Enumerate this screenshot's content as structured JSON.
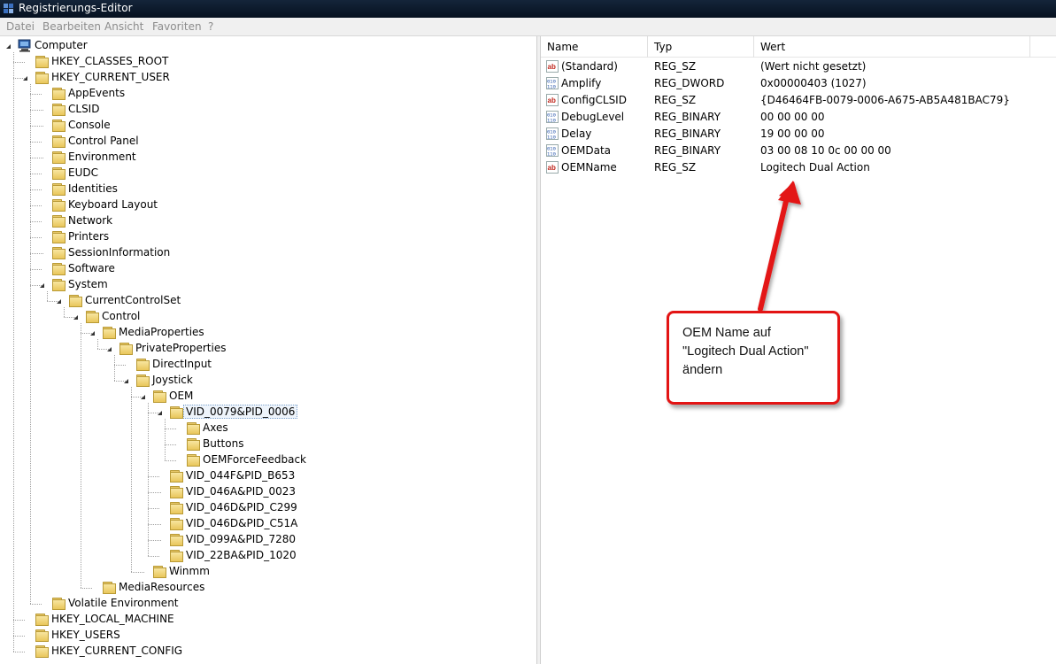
{
  "window": {
    "title": "Registrierungs-Editor"
  },
  "menu": [
    "Datei",
    "Bearbeiten",
    "Ansicht",
    "Favoriten",
    "?"
  ],
  "tree": [
    {
      "label": "Computer",
      "depth": 0,
      "state": "open",
      "icon": "computer-icon"
    },
    {
      "label": "HKEY_CLASSES_ROOT",
      "depth": 1,
      "state": "closed"
    },
    {
      "label": "HKEY_CURRENT_USER",
      "depth": 1,
      "state": "open"
    },
    {
      "label": "AppEvents",
      "depth": 2,
      "state": "closed"
    },
    {
      "label": "CLSID",
      "depth": 2,
      "state": "none"
    },
    {
      "label": "Console",
      "depth": 2,
      "state": "none"
    },
    {
      "label": "Control Panel",
      "depth": 2,
      "state": "closed"
    },
    {
      "label": "Environment",
      "depth": 2,
      "state": "none"
    },
    {
      "label": "EUDC",
      "depth": 2,
      "state": "closed"
    },
    {
      "label": "Identities",
      "depth": 2,
      "state": "closed"
    },
    {
      "label": "Keyboard Layout",
      "depth": 2,
      "state": "closed"
    },
    {
      "label": "Network",
      "depth": 2,
      "state": "closed"
    },
    {
      "label": "Printers",
      "depth": 2,
      "state": "closed"
    },
    {
      "label": "SessionInformation",
      "depth": 2,
      "state": "none"
    },
    {
      "label": "Software",
      "depth": 2,
      "state": "closed"
    },
    {
      "label": "System",
      "depth": 2,
      "state": "open"
    },
    {
      "label": "CurrentControlSet",
      "depth": 3,
      "state": "open"
    },
    {
      "label": "Control",
      "depth": 4,
      "state": "open"
    },
    {
      "label": "MediaProperties",
      "depth": 5,
      "state": "open"
    },
    {
      "label": "PrivateProperties",
      "depth": 6,
      "state": "open"
    },
    {
      "label": "DirectInput",
      "depth": 7,
      "state": "closed"
    },
    {
      "label": "Joystick",
      "depth": 7,
      "state": "open"
    },
    {
      "label": "OEM",
      "depth": 8,
      "state": "open"
    },
    {
      "label": "VID_0079&PID_0006",
      "depth": 9,
      "state": "open",
      "selected": true
    },
    {
      "label": "Axes",
      "depth": 10,
      "state": "closed"
    },
    {
      "label": "Buttons",
      "depth": 10,
      "state": "closed"
    },
    {
      "label": "OEMForceFeedback",
      "depth": 10,
      "state": "closed"
    },
    {
      "label": "VID_044F&PID_B653",
      "depth": 9,
      "state": "closed"
    },
    {
      "label": "VID_046A&PID_0023",
      "depth": 9,
      "state": "none"
    },
    {
      "label": "VID_046D&PID_C299",
      "depth": 9,
      "state": "closed"
    },
    {
      "label": "VID_046D&PID_C51A",
      "depth": 9,
      "state": "none"
    },
    {
      "label": "VID_099A&PID_7280",
      "depth": 9,
      "state": "none"
    },
    {
      "label": "VID_22BA&PID_1020",
      "depth": 9,
      "state": "closed"
    },
    {
      "label": "Winmm",
      "depth": 8,
      "state": "none"
    },
    {
      "label": "MediaResources",
      "depth": 5,
      "state": "closed"
    },
    {
      "label": "Volatile Environment",
      "depth": 2,
      "state": "closed"
    },
    {
      "label": "HKEY_LOCAL_MACHINE",
      "depth": 1,
      "state": "closed"
    },
    {
      "label": "HKEY_USERS",
      "depth": 1,
      "state": "closed"
    },
    {
      "label": "HKEY_CURRENT_CONFIG",
      "depth": 1,
      "state": "closed"
    }
  ],
  "columns": {
    "name": "Name",
    "type": "Typ",
    "value": "Wert"
  },
  "values": [
    {
      "name": "(Standard)",
      "type": "REG_SZ",
      "data": "(Wert nicht gesetzt)",
      "icon": "string-value-icon"
    },
    {
      "name": "Amplify",
      "type": "REG_DWORD",
      "data": "0x00000403 (1027)",
      "icon": "binary-value-icon"
    },
    {
      "name": "ConfigCLSID",
      "type": "REG_SZ",
      "data": "{D46464FB-0079-0006-A675-AB5A481BAC79}",
      "icon": "string-value-icon"
    },
    {
      "name": "DebugLevel",
      "type": "REG_BINARY",
      "data": "00 00 00 00",
      "icon": "binary-value-icon"
    },
    {
      "name": "Delay",
      "type": "REG_BINARY",
      "data": "19 00 00 00",
      "icon": "binary-value-icon"
    },
    {
      "name": "OEMData",
      "type": "REG_BINARY",
      "data": "03 00 08 10 0c 00 00 00",
      "icon": "binary-value-icon"
    },
    {
      "name": "OEMName",
      "type": "REG_SZ",
      "data": "Logitech Dual Action",
      "icon": "string-value-icon"
    }
  ],
  "callout": {
    "lines": [
      "OEM Name auf",
      "\"Logitech Dual Action\"",
      "ändern"
    ],
    "border_color": "#e31414"
  }
}
